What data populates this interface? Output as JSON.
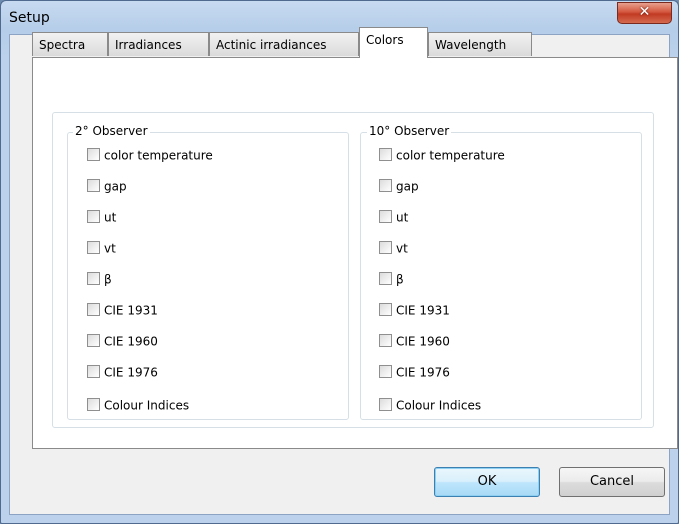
{
  "window": {
    "title": "Setup"
  },
  "tabs": [
    {
      "label": "Spectra",
      "active": false
    },
    {
      "label": "Irradiances",
      "active": false
    },
    {
      "label": "Actinic irradiances",
      "active": false
    },
    {
      "label": "Colors",
      "active": true
    },
    {
      "label": "Wavelength",
      "active": false
    }
  ],
  "groups": [
    {
      "title": "2° Observer",
      "options": [
        {
          "label": "color temperature",
          "checked": false
        },
        {
          "label": "gap",
          "checked": false
        },
        {
          "label": "ut",
          "checked": false
        },
        {
          "label": "vt",
          "checked": false
        },
        {
          "label": "β",
          "checked": false
        },
        {
          "label": "CIE 1931",
          "checked": false
        },
        {
          "label": "CIE 1960",
          "checked": false
        },
        {
          "label": "CIE 1976",
          "checked": false
        },
        {
          "label": "Colour Indices",
          "checked": false
        }
      ]
    },
    {
      "title": "10° Observer",
      "options": [
        {
          "label": "color temperature",
          "checked": false
        },
        {
          "label": "gap",
          "checked": false
        },
        {
          "label": "ut",
          "checked": false
        },
        {
          "label": "vt",
          "checked": false
        },
        {
          "label": "β",
          "checked": false
        },
        {
          "label": "CIE 1931",
          "checked": false
        },
        {
          "label": "CIE 1960",
          "checked": false
        },
        {
          "label": "CIE 1976",
          "checked": false
        },
        {
          "label": "Colour Indices",
          "checked": false
        }
      ]
    }
  ],
  "buttons": {
    "ok_label": "OK",
    "cancel_label": "Cancel",
    "close_glyph": "✕"
  }
}
